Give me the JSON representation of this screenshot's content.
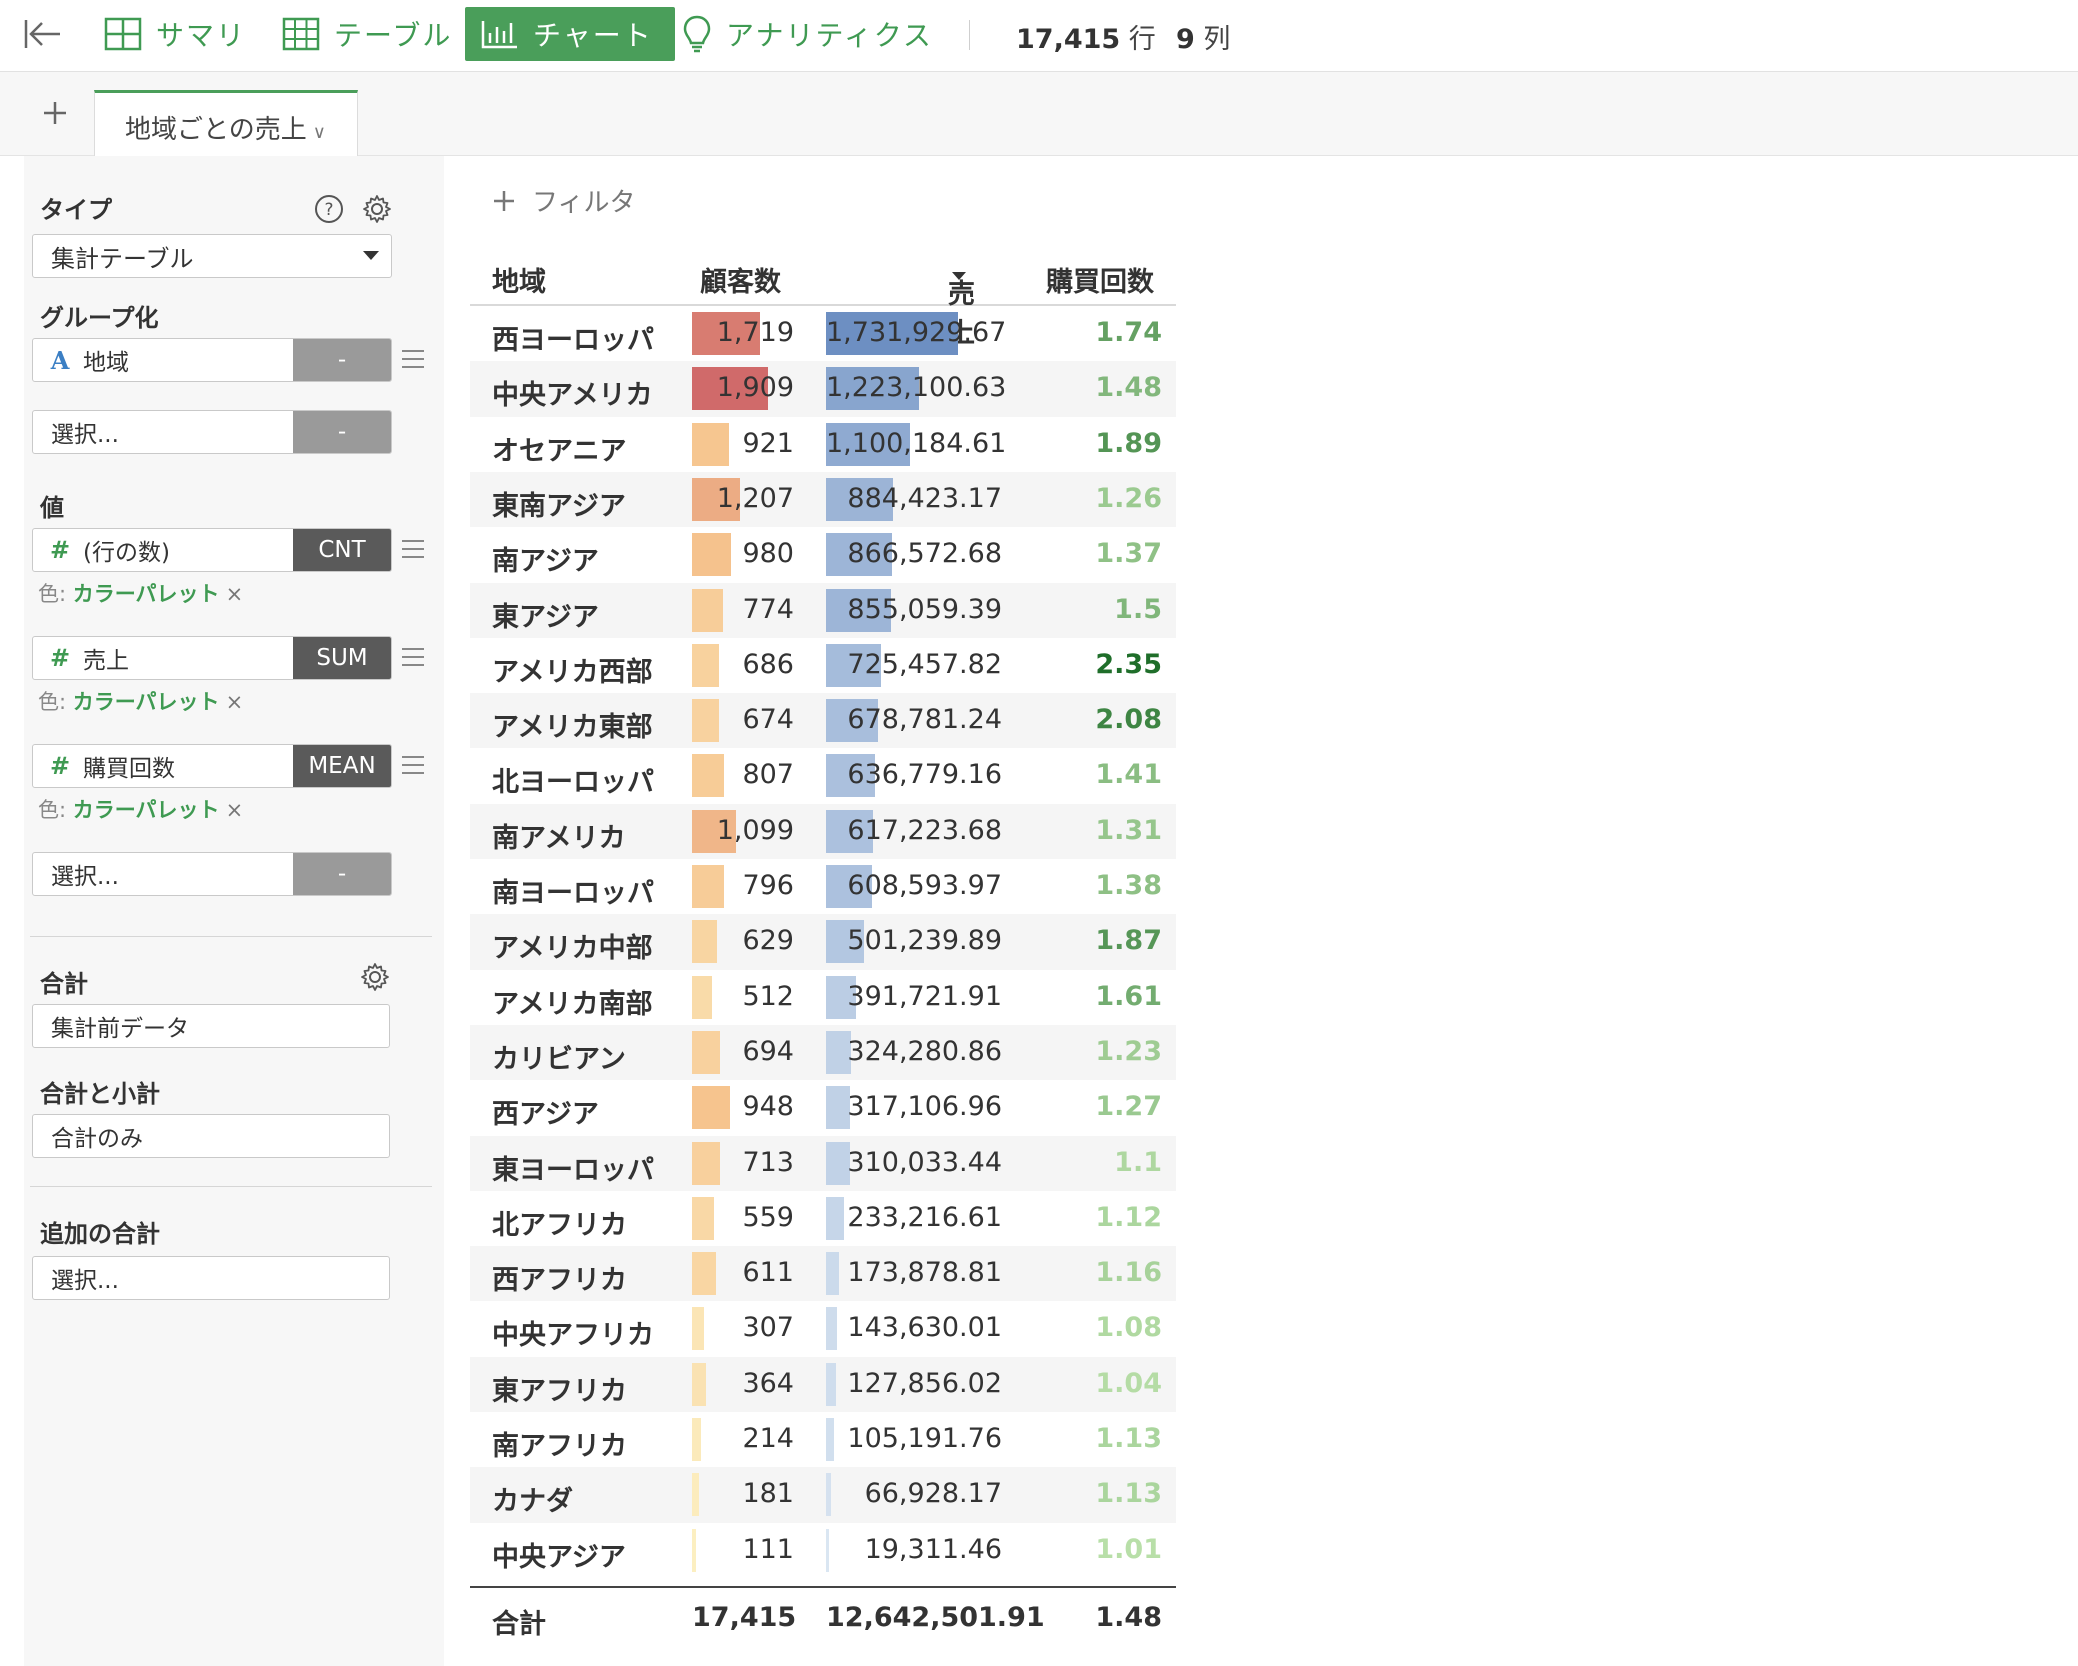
{
  "toolbar": {
    "tabs": [
      {
        "label": "サマリ"
      },
      {
        "label": "テーブル"
      },
      {
        "label": "チャート"
      },
      {
        "label": "アナリティクス"
      }
    ],
    "rows_count": "17,415",
    "rows_unit": "行",
    "cols_count": "9",
    "cols_unit": "列"
  },
  "sheet_tab": {
    "label": "地域ごとの売上"
  },
  "settings": {
    "type_title": "タイプ",
    "type_value": "集計テーブル",
    "group_title": "グループ化",
    "group_field": {
      "icon": "A",
      "name": "地域",
      "agg": "-"
    },
    "group_select": {
      "name": "選択...",
      "agg": "-"
    },
    "value_title": "値",
    "values": [
      {
        "icon": "#",
        "name": "(行の数)",
        "agg": "CNT",
        "color_prefix": "色:",
        "color_label": "カラーパレット",
        "remove": "×"
      },
      {
        "icon": "#",
        "name": "売上",
        "agg": "SUM",
        "color_prefix": "色:",
        "color_label": "カラーパレット",
        "remove": "×"
      },
      {
        "icon": "#",
        "name": "購買回数",
        "agg": "MEAN",
        "color_prefix": "色:",
        "color_label": "カラーパレット",
        "remove": "×"
      }
    ],
    "value_select": {
      "name": "選択...",
      "agg": "-"
    },
    "total_title": "合計",
    "total_value": "集計前データ",
    "subtotal_title": "合計と小計",
    "subtotal_value": "合計のみ",
    "extra_title": "追加の合計",
    "extra_value": "選択..."
  },
  "filter": {
    "label": "フィルタ"
  },
  "table": {
    "headers": {
      "region": "地域",
      "customers": "顧客数",
      "sales": "売上",
      "purchases": "購買回数"
    },
    "rows": [
      {
        "region": "西ヨーロッパ",
        "customers": "1,719",
        "sales": "1,731,929.67",
        "purchases": "1.74"
      },
      {
        "region": "中央アメリカ",
        "customers": "1,909",
        "sales": "1,223,100.63",
        "purchases": "1.48"
      },
      {
        "region": "オセアニア",
        "customers": "921",
        "sales": "1,100,184.61",
        "purchases": "1.89"
      },
      {
        "region": "東南アジア",
        "customers": "1,207",
        "sales": "884,423.17",
        "purchases": "1.26"
      },
      {
        "region": "南アジア",
        "customers": "980",
        "sales": "866,572.68",
        "purchases": "1.37"
      },
      {
        "region": "東アジア",
        "customers": "774",
        "sales": "855,059.39",
        "purchases": "1.5"
      },
      {
        "region": "アメリカ西部",
        "customers": "686",
        "sales": "725,457.82",
        "purchases": "2.35"
      },
      {
        "region": "アメリカ東部",
        "customers": "674",
        "sales": "678,781.24",
        "purchases": "2.08"
      },
      {
        "region": "北ヨーロッパ",
        "customers": "807",
        "sales": "636,779.16",
        "purchases": "1.41"
      },
      {
        "region": "南アメリカ",
        "customers": "1,099",
        "sales": "617,223.68",
        "purchases": "1.31"
      },
      {
        "region": "南ヨーロッパ",
        "customers": "796",
        "sales": "608,593.97",
        "purchases": "1.38"
      },
      {
        "region": "アメリカ中部",
        "customers": "629",
        "sales": "501,239.89",
        "purchases": "1.87"
      },
      {
        "region": "アメリカ南部",
        "customers": "512",
        "sales": "391,721.91",
        "purchases": "1.61"
      },
      {
        "region": "カリビアン",
        "customers": "694",
        "sales": "324,280.86",
        "purchases": "1.23"
      },
      {
        "region": "西アジア",
        "customers": "948",
        "sales": "317,106.96",
        "purchases": "1.27"
      },
      {
        "region": "東ヨーロッパ",
        "customers": "713",
        "sales": "310,033.44",
        "purchases": "1.1"
      },
      {
        "region": "北アフリカ",
        "customers": "559",
        "sales": "233,216.61",
        "purchases": "1.12"
      },
      {
        "region": "西アフリカ",
        "customers": "611",
        "sales": "173,878.81",
        "purchases": "1.16"
      },
      {
        "region": "中央アフリカ",
        "customers": "307",
        "sales": "143,630.01",
        "purchases": "1.08"
      },
      {
        "region": "東アフリカ",
        "customers": "364",
        "sales": "127,856.02",
        "purchases": "1.04"
      },
      {
        "region": "南アフリカ",
        "customers": "214",
        "sales": "105,191.76",
        "purchases": "1.13"
      },
      {
        "region": "カナダ",
        "customers": "181",
        "sales": "66,928.17",
        "purchases": "1.13"
      },
      {
        "region": "中央アジア",
        "customers": "111",
        "sales": "19,311.46",
        "purchases": "1.01"
      }
    ],
    "totals": {
      "label": "合計",
      "customers": "17,415",
      "sales": "12,642,501.91",
      "purchases": "1.48"
    }
  },
  "colors": {
    "accent": "#4a9e5a",
    "customers_low": "#fdf5c8",
    "customers_mid": "#f6c48e",
    "customers_high": "#d06a6a",
    "sales_low": "#dde8f3",
    "sales_high": "#6d8fc2",
    "purchases_low": "#b8dfa8",
    "purchases_high": "#1f6e2a"
  }
}
